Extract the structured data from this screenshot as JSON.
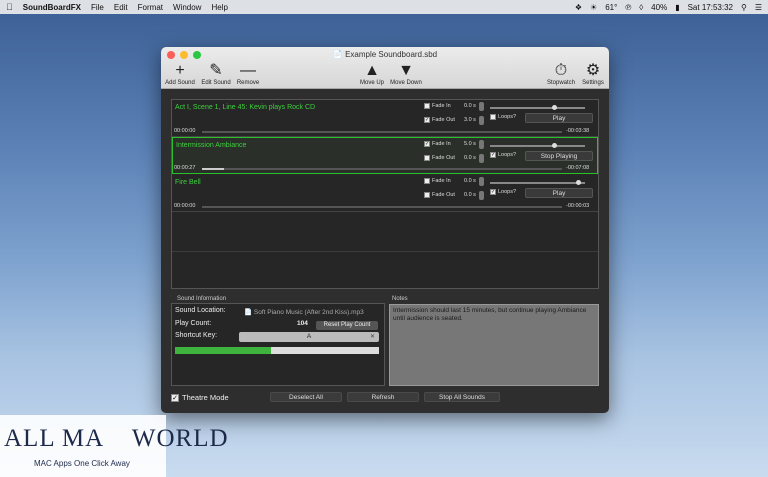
{
  "menubar": {
    "app_name": "SoundBoardFX",
    "items": [
      "File",
      "Edit",
      "Format",
      "Window",
      "Help"
    ],
    "weather": "61°",
    "battery": "40%",
    "clock": "Sat 17:53:32"
  },
  "window": {
    "title": "Example Soundboard.sbd"
  },
  "toolbar": {
    "add_sound": "Add Sound",
    "edit_sound": "Edit Sound",
    "remove": "Remove",
    "move_up": "Move Up",
    "move_down": "Move Down",
    "stopwatch": "Stopwatch",
    "settings": "Settings"
  },
  "sounds": [
    {
      "name": "Act I, Scene 1, Line 45: Kevin plays Rock CD",
      "fade_in_label": "Fade In",
      "fade_in_checked": false,
      "fade_in_value": "0.0 s",
      "fade_out_label": "Fade Out",
      "fade_out_checked": true,
      "fade_out_value": "3.0 s",
      "loops_label": "Loops?",
      "loops_checked": false,
      "button": "Play",
      "elapsed": "00:00:00",
      "remaining": "-00:03:38",
      "volume": 0.65,
      "progress": 0.0
    },
    {
      "name": "Intermission Ambiance",
      "fade_in_label": "Fade In",
      "fade_in_checked": true,
      "fade_in_value": "5.0 s",
      "fade_out_label": "Fade Out",
      "fade_out_checked": false,
      "fade_out_value": "0.0 s",
      "loops_label": "Loops?",
      "loops_checked": true,
      "button": "Stop Playing",
      "elapsed": "00:00:27",
      "remaining": "-00:07:08",
      "volume": 0.65,
      "progress": 0.06
    },
    {
      "name": "Fire Bell",
      "fade_in_label": "Fade In",
      "fade_in_checked": false,
      "fade_in_value": "0.0 s",
      "fade_out_label": "Fade Out",
      "fade_out_checked": false,
      "fade_out_value": "0.0 s",
      "loops_label": "Loops?",
      "loops_checked": true,
      "button": "Play",
      "elapsed": "00:00:00",
      "remaining": "-00:00:03",
      "volume": 0.9,
      "progress": 0.0
    }
  ],
  "sound_info": {
    "panel_title": "Sound Information",
    "location_label": "Sound Location:",
    "location_value": "Soft Piano Music (After 2nd Kiss).mp3",
    "play_count_label": "Play Count:",
    "play_count_value": "104",
    "reset_button": "Reset Play Count",
    "shortcut_label": "Shortcut Key:",
    "shortcut_value": "A",
    "level": 0.47
  },
  "notes": {
    "panel_title": "Notes",
    "text": "Intermission should last 15 minutes, but continue playing Ambiance until audience is seated."
  },
  "bottom": {
    "theatre_mode": "Theatre Mode",
    "theatre_checked": true,
    "deselect_all": "Deselect All",
    "refresh": "Refresh",
    "stop_all": "Stop All Sounds"
  },
  "watermark": {
    "title_a": "ALL MA",
    "title_b": " WORLD",
    "subtitle": "MAC Apps One Click Away"
  }
}
